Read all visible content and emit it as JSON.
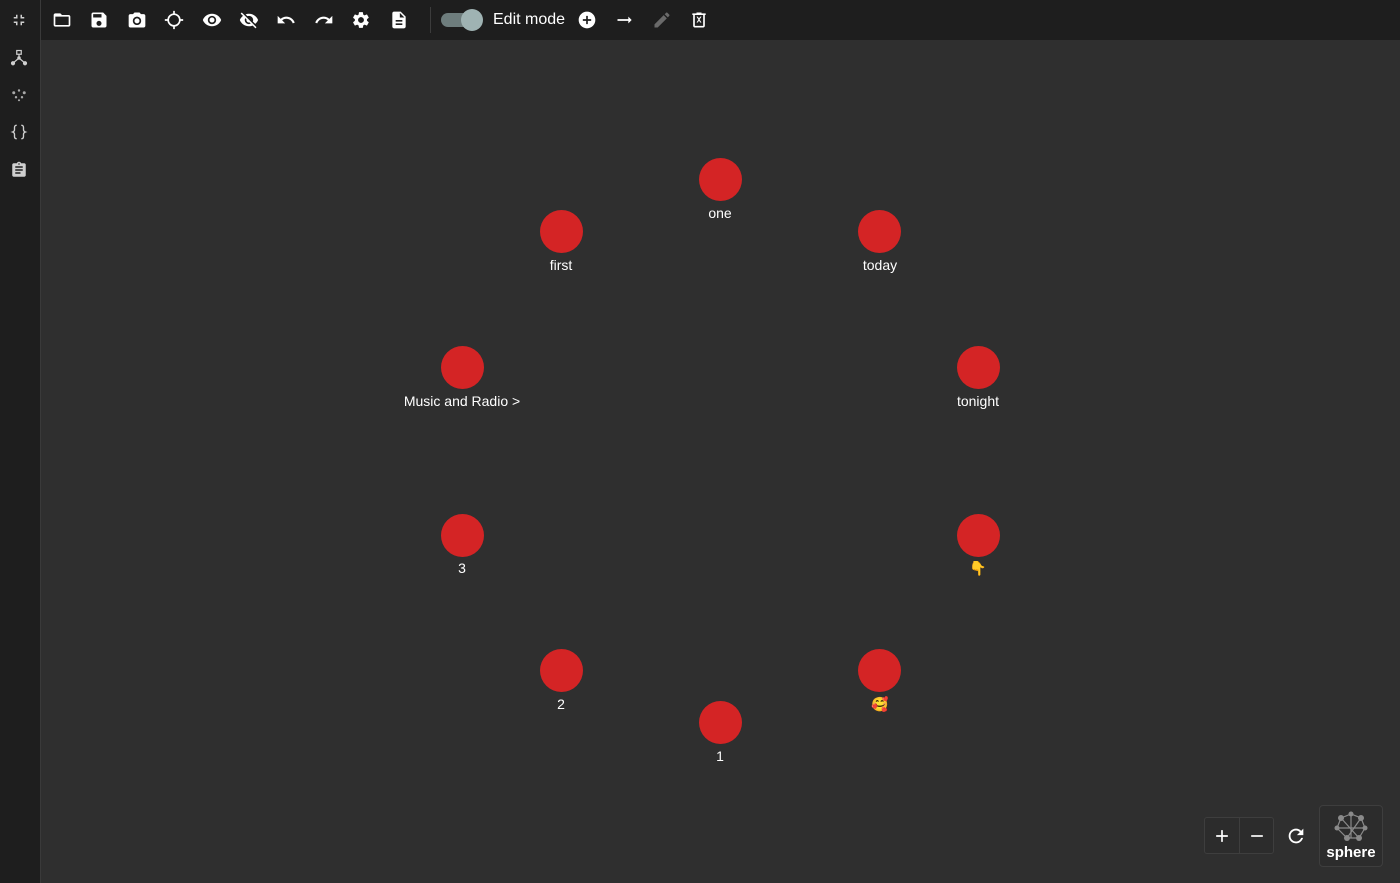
{
  "toolbar": {
    "edit_mode_label": "Edit mode",
    "edit_mode_on": true,
    "buttons": [
      "folder-open-icon",
      "save-icon",
      "camera-icon",
      "crosshair-icon",
      "eye-icon",
      "eye-off-icon",
      "undo-icon",
      "redo-icon",
      "settings-icon",
      "document-icon"
    ],
    "edit_buttons": [
      "add-circle-icon",
      "arrow-right-icon",
      "pencil-icon",
      "delete-icon"
    ]
  },
  "sidebar": {
    "items": [
      "collapse-icon",
      "graph-tree-icon",
      "scatter-dots-icon",
      "json-braces-icon",
      "clipboard-icon"
    ]
  },
  "graph": {
    "node_color": "#d42425",
    "nodes": [
      {
        "label": "one"
      },
      {
        "label": "today"
      },
      {
        "label": "tonight"
      },
      {
        "label": "👇"
      },
      {
        "label": "🥰"
      },
      {
        "label": "1"
      },
      {
        "label": "2"
      },
      {
        "label": "3"
      },
      {
        "label": "Music and Radio >"
      },
      {
        "label": "first"
      }
    ]
  },
  "controls": {
    "zoom_in_icon": "plus-icon",
    "zoom_out_icon": "minus-icon",
    "reset_icon": "refresh-icon",
    "layout_label": "sphere"
  }
}
